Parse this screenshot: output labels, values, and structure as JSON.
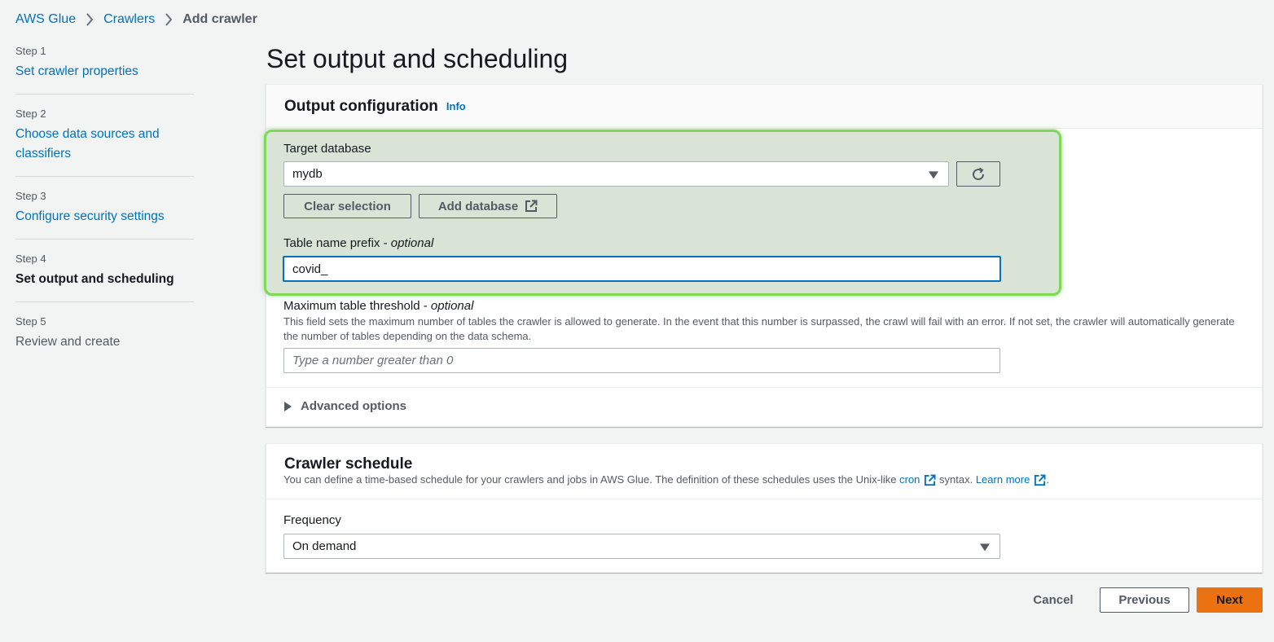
{
  "breadcrumb": {
    "items": [
      "AWS Glue",
      "Crawlers"
    ],
    "current": "Add crawler"
  },
  "steps": [
    {
      "num": "Step 1",
      "title": "Set crawler properties",
      "state": "link"
    },
    {
      "num": "Step 2",
      "title": "Choose data sources and classifiers",
      "state": "link"
    },
    {
      "num": "Step 3",
      "title": "Configure security settings",
      "state": "link"
    },
    {
      "num": "Step 4",
      "title": "Set output and scheduling",
      "state": "active"
    },
    {
      "num": "Step 5",
      "title": "Review and create",
      "state": "disabled"
    }
  ],
  "page_title": "Set output and scheduling",
  "output_config": {
    "heading": "Output configuration",
    "info": "Info",
    "target_db_label": "Target database",
    "target_db_value": "mydb",
    "clear_selection": "Clear selection",
    "add_database": "Add database",
    "prefix_label": "Table name prefix - ",
    "prefix_optional": "optional",
    "prefix_value": "covid_",
    "threshold_label": "Maximum table threshold - ",
    "threshold_optional": "optional",
    "threshold_desc": "This field sets the maximum number of tables the crawler is allowed to generate. In the event that this number is surpassed, the crawl will fail with an error. If not set, the crawler will automatically generate the number of tables depending on the data schema.",
    "threshold_placeholder": "Type a number greater than 0",
    "advanced": "Advanced options"
  },
  "schedule": {
    "heading": "Crawler schedule",
    "desc_pre": "You can define a time-based schedule for your crawlers and jobs in AWS Glue. The definition of these schedules uses the Unix-like ",
    "cron_link": "cron",
    "desc_mid": " syntax. ",
    "learn_more": "Learn more",
    "desc_end": ".",
    "frequency_label": "Frequency",
    "frequency_value": "On demand"
  },
  "footer": {
    "cancel": "Cancel",
    "previous": "Previous",
    "next": "Next"
  },
  "colors": {
    "link": "#0073bb",
    "primary_button": "#ec7211",
    "highlight_fill": "#d9e4d6",
    "highlight_border": "#7ed957"
  }
}
